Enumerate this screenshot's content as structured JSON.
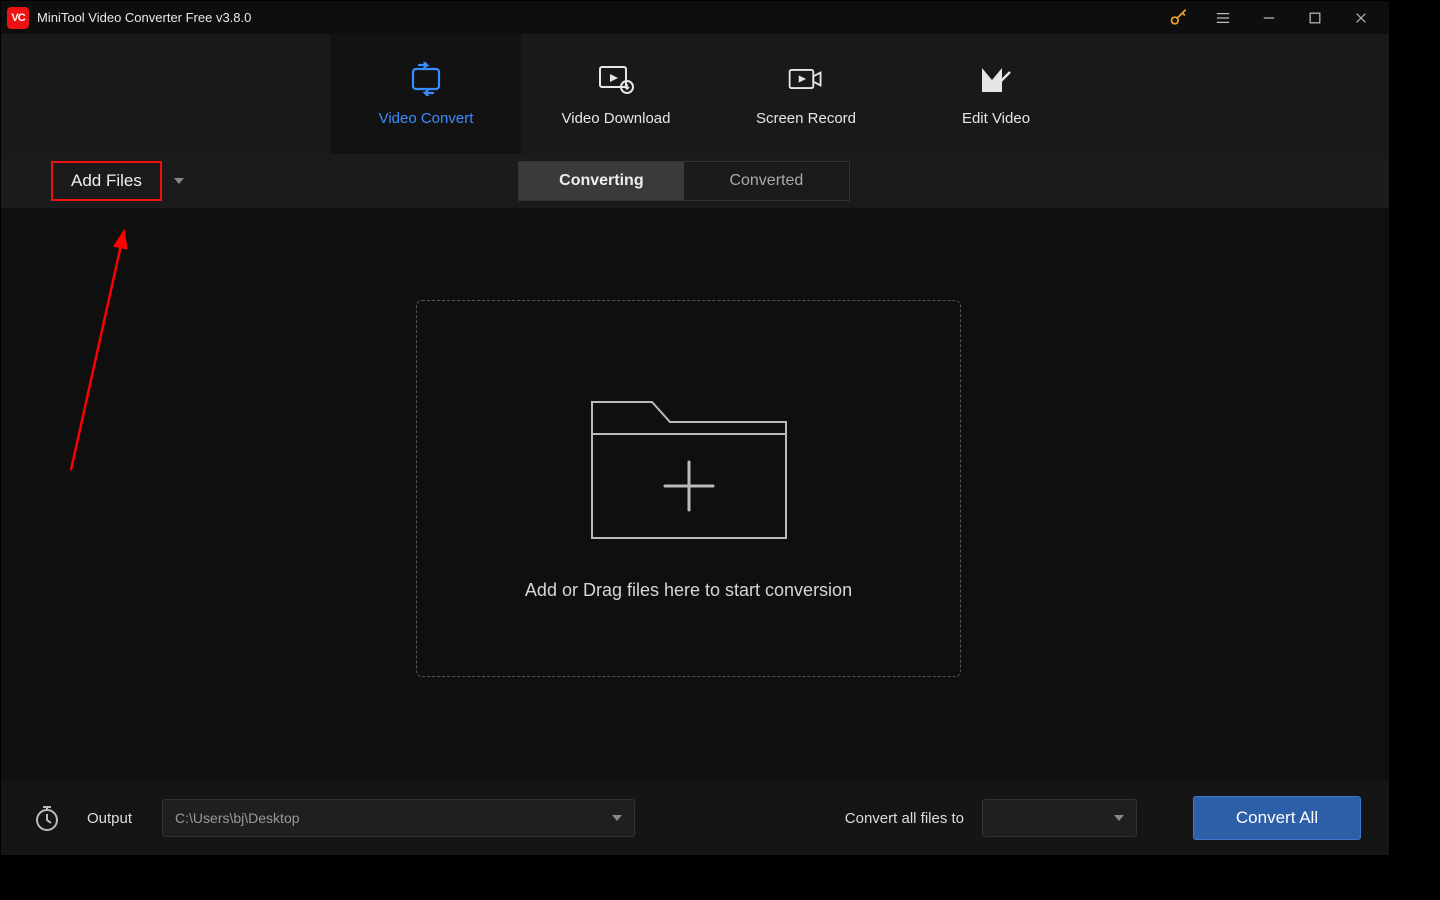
{
  "titlebar": {
    "title": "MiniTool Video Converter Free v3.8.0"
  },
  "nav": {
    "tabs": [
      {
        "label": "Video Convert"
      },
      {
        "label": "Video Download"
      },
      {
        "label": "Screen Record"
      },
      {
        "label": "Edit Video"
      }
    ]
  },
  "toolbar": {
    "add_files_label": "Add Files",
    "seg_converting": "Converting",
    "seg_converted": "Converted"
  },
  "dropzone": {
    "text": "Add or Drag files here to start conversion"
  },
  "bottom": {
    "output_label": "Output",
    "output_path": "C:\\Users\\bj\\Desktop",
    "convert_all_label": "Convert all files to",
    "format_value": "",
    "convert_all_btn": "Convert All"
  }
}
